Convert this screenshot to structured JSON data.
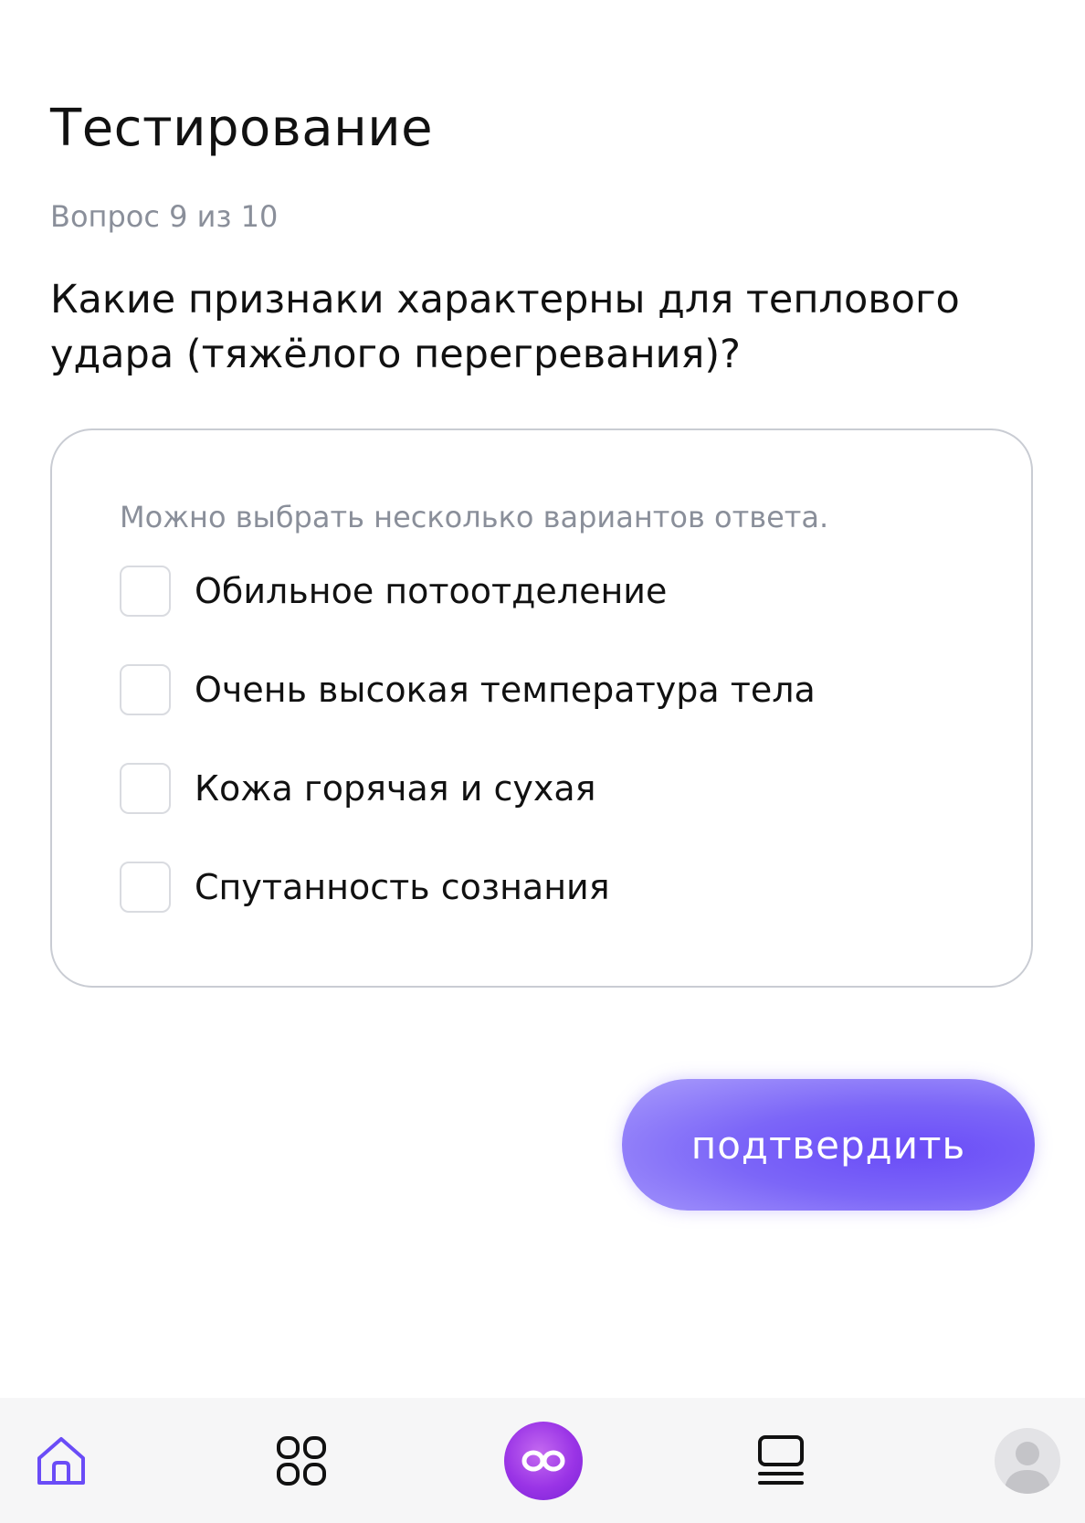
{
  "header": {
    "title": "Тестирование",
    "counter": "Вопрос 9 из 10"
  },
  "question": {
    "text": "Какие признаки характерны для теплового удара (тяжёлого перегревания)?",
    "hint": "Можно выбрать несколько вариантов ответа.",
    "options": [
      {
        "label": "Обильное потоотделение",
        "checked": false
      },
      {
        "label": "Очень высокая температура тела",
        "checked": false
      },
      {
        "label": "Кожа горячая и сухая",
        "checked": false
      },
      {
        "label": "Спутанность сознания",
        "checked": false
      }
    ]
  },
  "actions": {
    "confirm_label": "подтвердить"
  },
  "bottom_nav": {
    "items": [
      {
        "icon": "home-icon",
        "active": true
      },
      {
        "icon": "grid-icon",
        "active": false
      },
      {
        "icon": "infinity-icon",
        "active": false
      },
      {
        "icon": "feed-icon",
        "active": false
      },
      {
        "icon": "profile-icon",
        "active": false
      }
    ]
  },
  "colors": {
    "accent": "#6a4cf7",
    "accent_light": "#a99cfb",
    "assistant": "#9a34e6",
    "muted_text": "#8a8f9a",
    "card_border": "#c9ccd3"
  }
}
